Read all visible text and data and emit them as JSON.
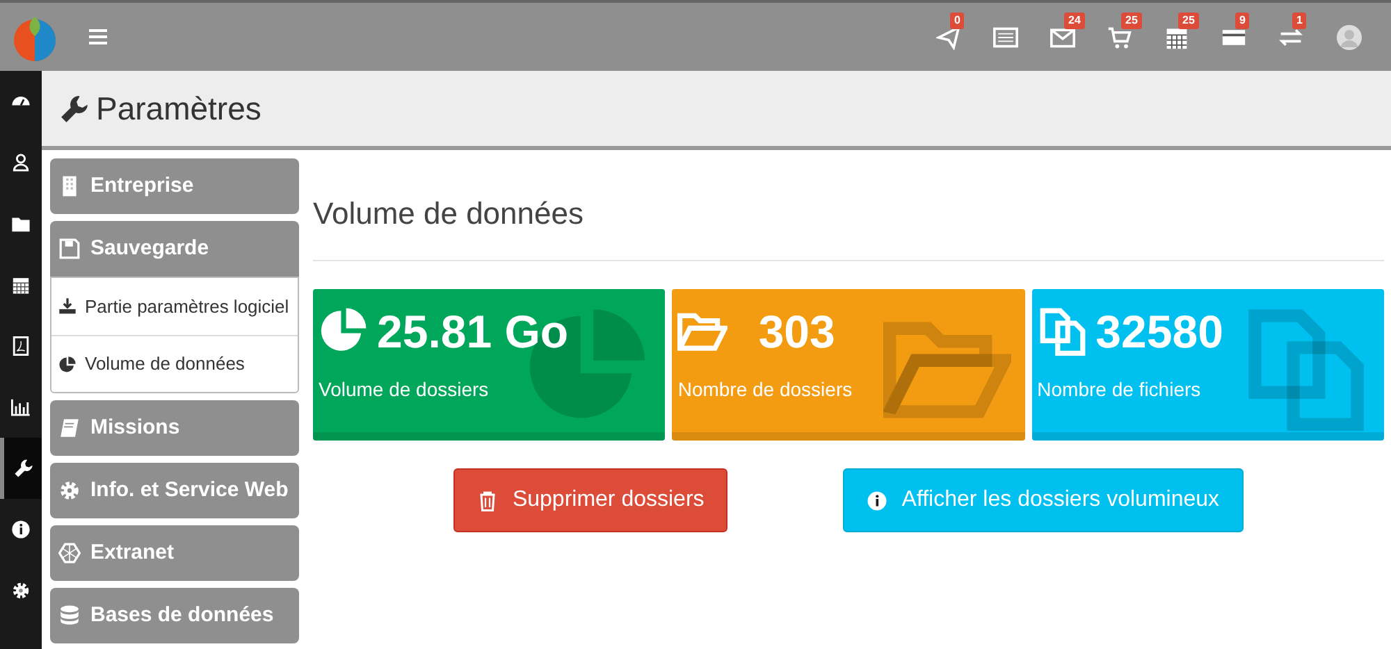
{
  "topbar": {
    "icons": [
      {
        "kind": "send",
        "badge": "0"
      },
      {
        "kind": "list"
      },
      {
        "kind": "mail",
        "badge": "24"
      },
      {
        "kind": "cart",
        "badge": "25"
      },
      {
        "kind": "calendar",
        "badge": "25"
      },
      {
        "kind": "card",
        "badge": "9"
      },
      {
        "kind": "exchange",
        "badge": "1"
      },
      {
        "kind": "avatar"
      }
    ]
  },
  "rail": [
    {
      "kind": "dashboard",
      "selected": false
    },
    {
      "kind": "user",
      "selected": false
    },
    {
      "kind": "folder",
      "selected": false
    },
    {
      "kind": "calendar",
      "selected": false
    },
    {
      "kind": "pdf",
      "selected": false
    },
    {
      "kind": "chart",
      "selected": false
    },
    {
      "kind": "wrench",
      "selected": true
    },
    {
      "kind": "info",
      "selected": false
    },
    {
      "kind": "gear",
      "selected": false
    }
  ],
  "page_title": "Paramètres",
  "sidebar": {
    "items": [
      {
        "kind": "building",
        "label": "Entreprise",
        "expanded": false
      },
      {
        "kind": "save",
        "label": "Sauvegarde",
        "expanded": true,
        "children": [
          {
            "kind": "download",
            "label": "Partie paramètres logiciel"
          },
          {
            "kind": "pie",
            "label": "Volume de données"
          }
        ]
      },
      {
        "kind": "book",
        "label": "Missions",
        "expanded": false
      },
      {
        "kind": "gear",
        "label": "Info. et Service Web",
        "expanded": false
      },
      {
        "kind": "globe",
        "label": "Extranet",
        "expanded": false
      },
      {
        "kind": "database",
        "label": "Bases de données",
        "expanded": false
      }
    ]
  },
  "section_title": "Volume de données",
  "stats": [
    {
      "kind": "pie",
      "value": "25.81 Go",
      "label": "Volume de dossiers",
      "color": "#00a65a"
    },
    {
      "kind": "folder",
      "value": "303",
      "label": "Nombre de dossiers",
      "color": "#f39c12"
    },
    {
      "kind": "files",
      "value": "32580",
      "label": "Nombre de fichiers",
      "color": "#00c0ef"
    }
  ],
  "buttons": [
    {
      "kind": "danger",
      "label": "Supprimer dossiers"
    },
    {
      "kind": "info",
      "label": "Afficher les dossiers volumineux"
    }
  ]
}
